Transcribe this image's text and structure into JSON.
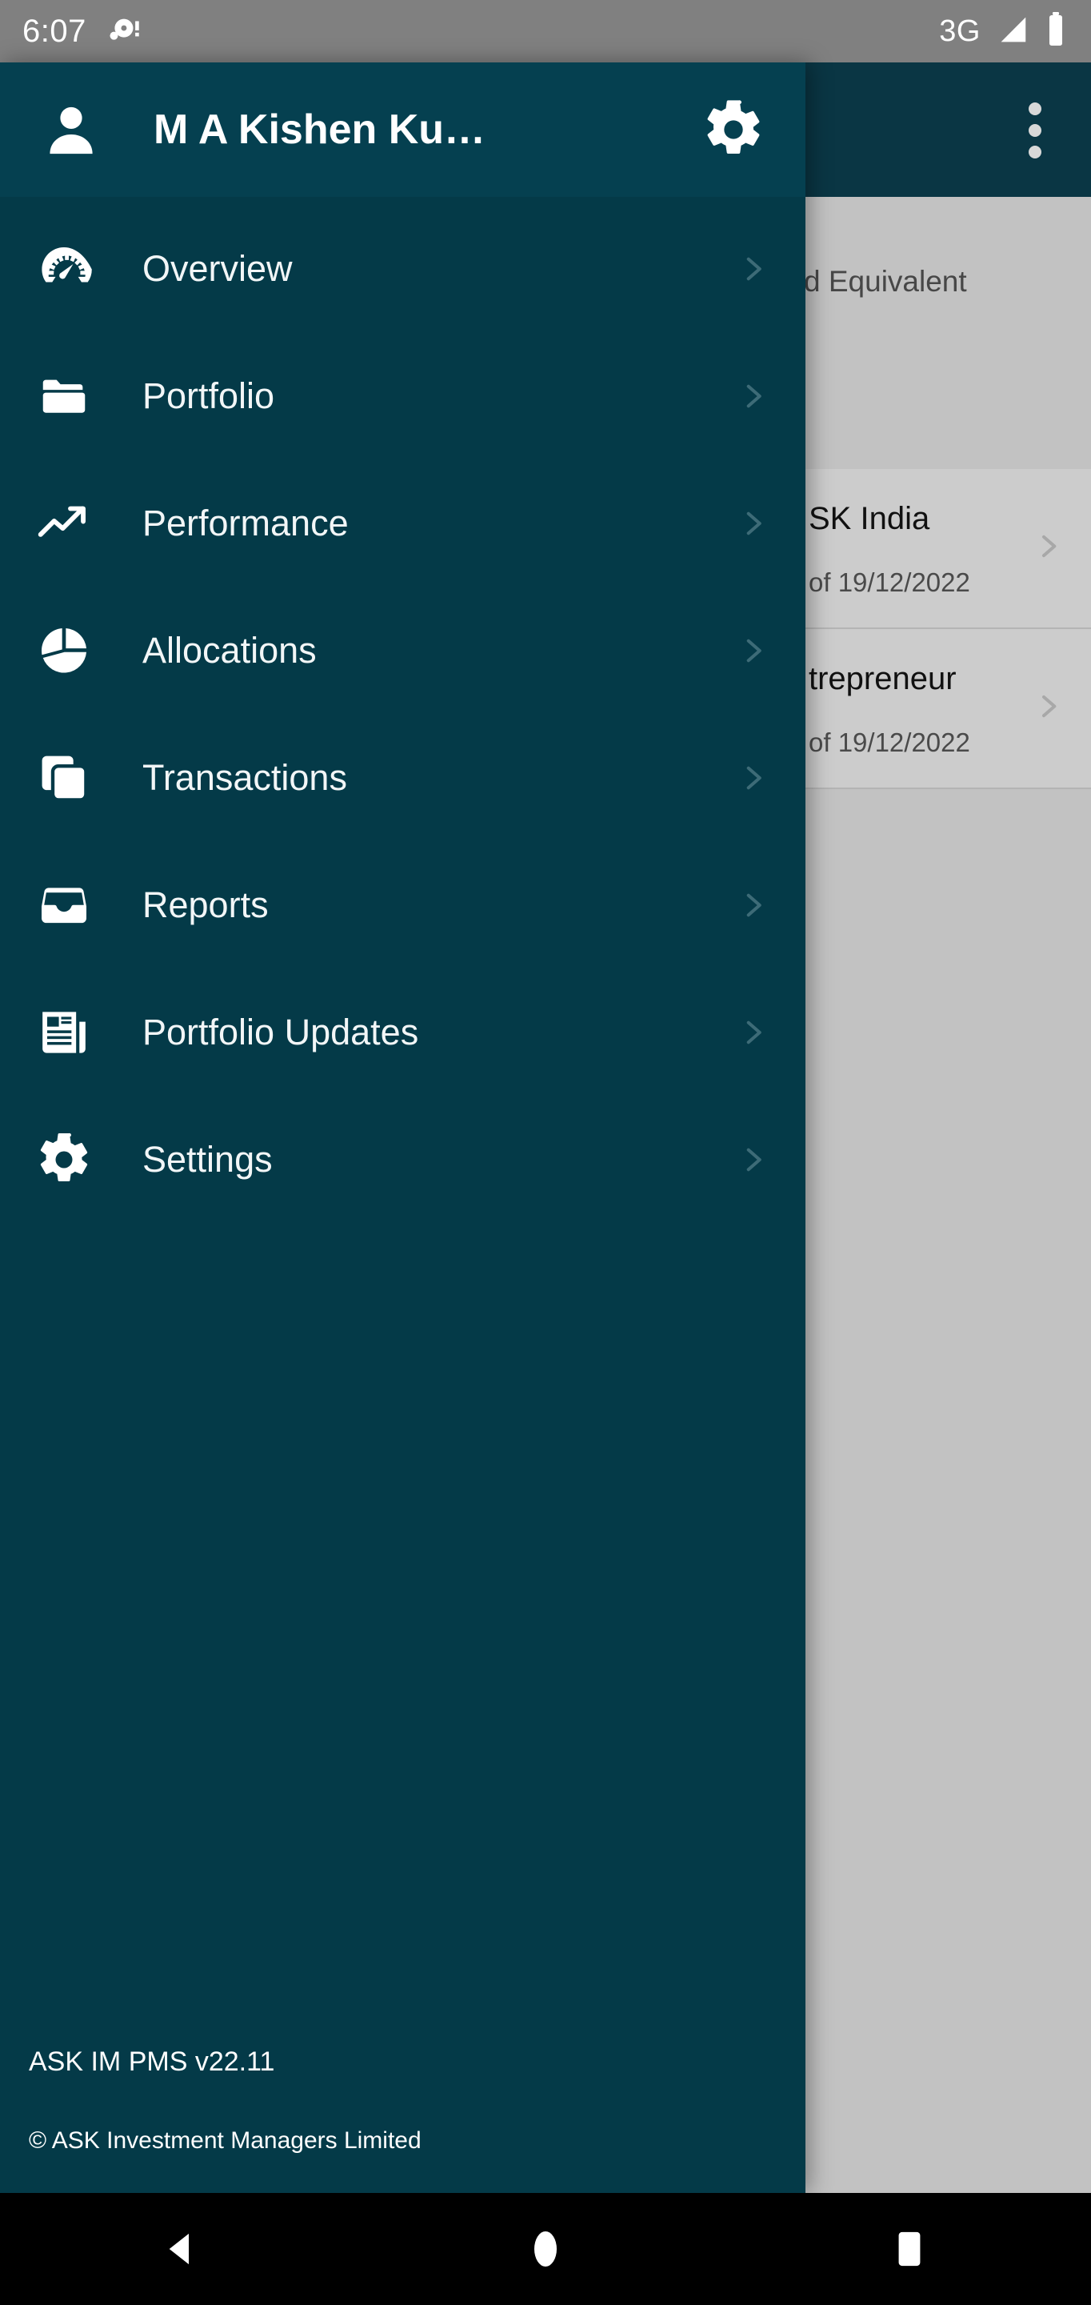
{
  "status_bar": {
    "time": "6:07",
    "network": "3G",
    "icons": [
      "notification-dot-icon",
      "signal-icon",
      "battery-icon"
    ]
  },
  "drawer": {
    "title": "M A Kishen Ku…",
    "avatar_icon": "person-icon",
    "settings_icon": "gear-icon",
    "chevron_icon": "chevron-right-icon",
    "items": [
      {
        "label": "Overview",
        "icon": "speedometer-icon"
      },
      {
        "label": "Portfolio",
        "icon": "folder-icon"
      },
      {
        "label": "Performance",
        "icon": "trending-up-icon"
      },
      {
        "label": "Allocations",
        "icon": "pie-chart-icon"
      },
      {
        "label": "Transactions",
        "icon": "layers-copy-icon"
      },
      {
        "label": "Reports",
        "icon": "inbox-tray-icon"
      },
      {
        "label": "Portfolio Updates",
        "icon": "newspaper-icon"
      },
      {
        "label": "Settings",
        "icon": "gear-icon"
      }
    ],
    "footer": {
      "version": "ASK IM PMS v22.11",
      "copyright": "© ASK Investment Managers Limited"
    }
  },
  "background_app": {
    "overflow_icon": "more-vertical-icon",
    "section_title": "d Equivalent",
    "cards": [
      {
        "name": "SK India",
        "subtitle": "of 19/12/2022",
        "chevron": "chevron-right-icon"
      },
      {
        "name": "trepreneur",
        "subtitle": "of 19/12/2022",
        "chevron": "chevron-right-icon"
      }
    ]
  },
  "system_nav": {
    "back_label": "back-button",
    "home_label": "home-button",
    "recents_label": "recents-button"
  },
  "colors": {
    "drawer_bg": "#043a48",
    "drawer_header_bg": "#054050",
    "status_bar_bg": "#808080",
    "dim_overlay": "#c2c2c2",
    "chevron": "#3d6b77",
    "nav_bar_bg": "#000000"
  }
}
